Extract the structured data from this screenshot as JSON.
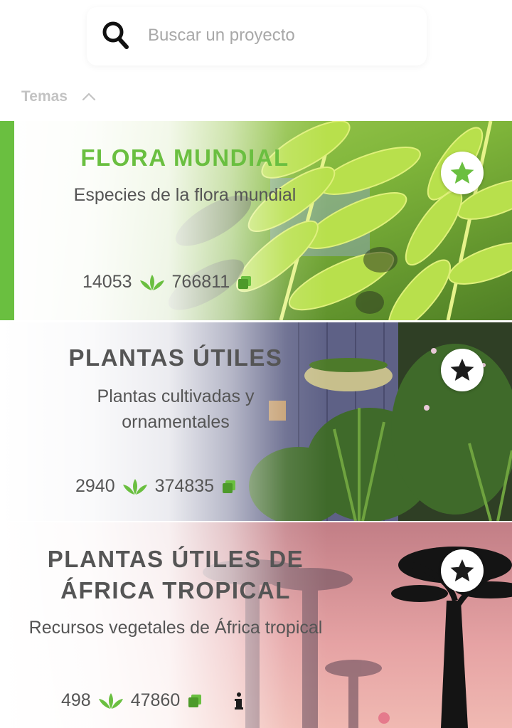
{
  "search": {
    "placeholder": "Buscar un proyecto"
  },
  "topics": {
    "label": "Temas"
  },
  "colors": {
    "accent": "#6abf40",
    "text": "#555555",
    "placeholder": "#a8a8a8"
  },
  "projects": [
    {
      "title": "FLORA MUNDIAL",
      "subtitle": "Especies de la flora mundial",
      "species_count": "14053",
      "observations_count": "766811",
      "starred": true,
      "active": true
    },
    {
      "title": "PLANTAS ÚTILES",
      "subtitle": "Plantas cultivadas y ornamentales",
      "species_count": "2940",
      "observations_count": "374835",
      "starred": false,
      "active": false
    },
    {
      "title": "PLANTAS ÚTILES DE ÁFRICA TROPICAL",
      "subtitle": "Recursos vegetales de África tropical",
      "species_count": "498",
      "observations_count": "47860",
      "starred": false,
      "active": false,
      "has_info": true
    }
  ]
}
